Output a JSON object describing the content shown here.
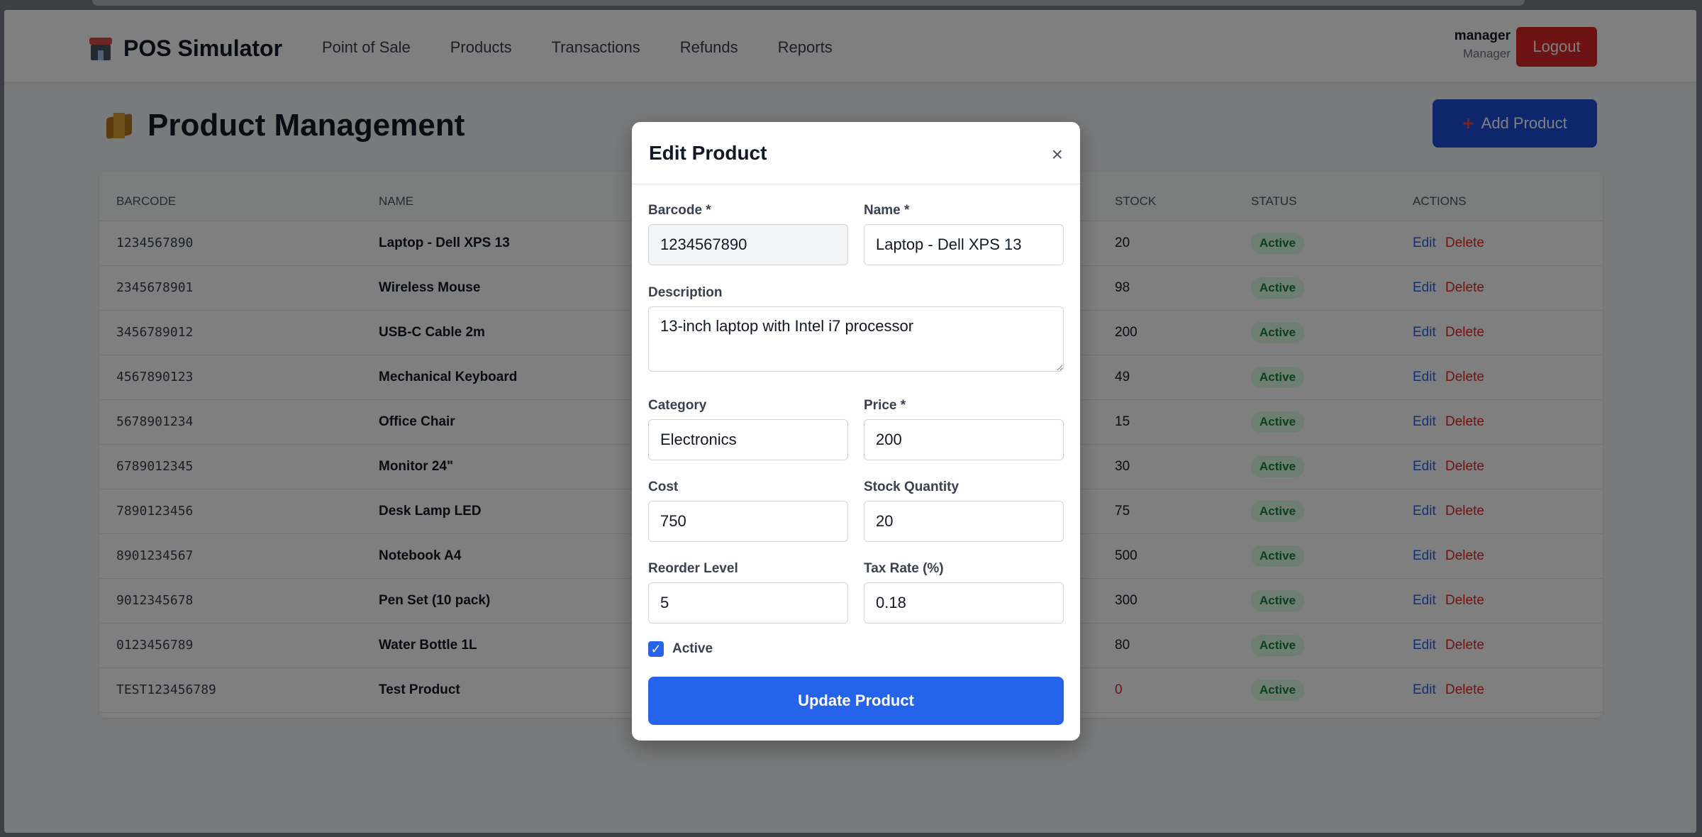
{
  "app": {
    "title": "POS Simulator",
    "nav": [
      "Point of Sale",
      "Products",
      "Transactions",
      "Refunds",
      "Reports"
    ],
    "user": {
      "name": "manager",
      "role": "Manager"
    },
    "logout_label": "Logout"
  },
  "page": {
    "title": "Product Management",
    "add_button_icon": "+",
    "add_button_label": "Add Product"
  },
  "table": {
    "headers": [
      "BARCODE",
      "NAME",
      "STOCK",
      "STATUS",
      "ACTIONS"
    ],
    "edit_label": "Edit",
    "delete_label": "Delete",
    "rows": [
      {
        "barcode": "1234567890",
        "name": "Laptop - Dell XPS 13",
        "stock": "20",
        "status": "Active"
      },
      {
        "barcode": "2345678901",
        "name": "Wireless Mouse",
        "stock": "98",
        "status": "Active"
      },
      {
        "barcode": "3456789012",
        "name": "USB-C Cable 2m",
        "stock": "200",
        "status": "Active"
      },
      {
        "barcode": "4567890123",
        "name": "Mechanical Keyboard",
        "stock": "49",
        "status": "Active"
      },
      {
        "barcode": "5678901234",
        "name": "Office Chair",
        "stock": "15",
        "status": "Active"
      },
      {
        "barcode": "6789012345",
        "name": "Monitor 24\"",
        "stock": "30",
        "status": "Active"
      },
      {
        "barcode": "7890123456",
        "name": "Desk Lamp LED",
        "stock": "75",
        "status": "Active"
      },
      {
        "barcode": "8901234567",
        "name": "Notebook A4",
        "stock": "500",
        "status": "Active"
      },
      {
        "barcode": "9012345678",
        "name": "Pen Set (10 pack)",
        "stock": "300",
        "status": "Active"
      },
      {
        "barcode": "0123456789",
        "name": "Water Bottle 1L",
        "stock": "80",
        "status": "Active"
      },
      {
        "barcode": "TEST123456789",
        "name": "Test Product",
        "stock": "0",
        "status": "Active"
      }
    ]
  },
  "modal": {
    "title": "Edit Product",
    "close_glyph": "×",
    "fields": {
      "barcode": {
        "label": "Barcode *",
        "value": "1234567890"
      },
      "name": {
        "label": "Name *",
        "value": "Laptop - Dell XPS 13"
      },
      "description": {
        "label": "Description",
        "value": "13-inch laptop with Intel i7 processor"
      },
      "category": {
        "label": "Category",
        "value": "Electronics"
      },
      "price": {
        "label": "Price *",
        "value": "200"
      },
      "cost": {
        "label": "Cost",
        "value": "750"
      },
      "stock_quantity": {
        "label": "Stock Quantity",
        "value": "20"
      },
      "reorder_level": {
        "label": "Reorder Level",
        "value": "5"
      },
      "tax_rate": {
        "label": "Tax Rate (%)",
        "value": "0.18"
      }
    },
    "active_label": "Active",
    "active_checked": true,
    "submit_label": "Update Product"
  },
  "colors": {
    "primary": "#2563eb",
    "danger": "#dc2626",
    "success_bg": "#dcfce7",
    "success_text": "#15803d"
  }
}
